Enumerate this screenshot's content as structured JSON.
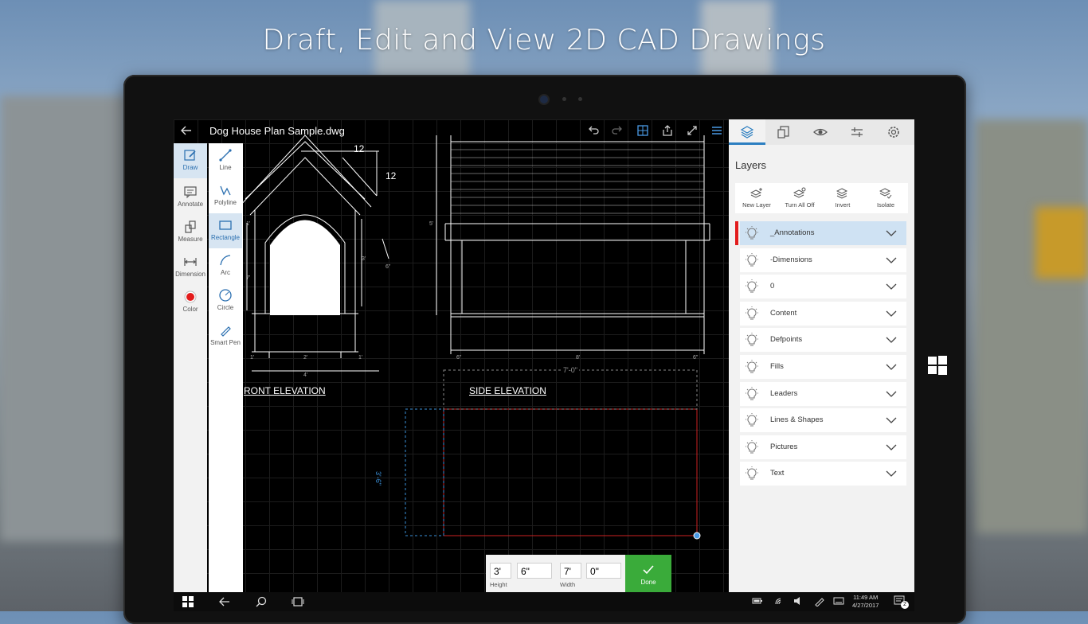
{
  "headline": "Draft, Edit and View 2D CAD Drawings",
  "document": {
    "title": "Dog House Plan Sample.dwg"
  },
  "toolbar_icons": [
    "undo-icon",
    "redo-icon",
    "grid-icon",
    "share-icon",
    "fullscreen-icon",
    "menu-icon"
  ],
  "tools": {
    "col1": [
      {
        "label": "Draw",
        "icon": "draw-icon",
        "active": true
      },
      {
        "label": "Annotate",
        "icon": "annotate-icon",
        "active": false
      },
      {
        "label": "Measure",
        "icon": "measure-icon",
        "active": false
      },
      {
        "label": "Dimension",
        "icon": "dimension-icon",
        "active": false
      },
      {
        "label": "Color",
        "icon": "color-dot-icon",
        "active": false
      }
    ],
    "col2": [
      {
        "label": "Line",
        "icon": "line-icon",
        "active": false
      },
      {
        "label": "Polyline",
        "icon": "polyline-icon",
        "active": false
      },
      {
        "label": "Rectangle",
        "icon": "rectangle-icon",
        "active": true
      },
      {
        "label": "Arc",
        "icon": "arc-icon",
        "active": false
      },
      {
        "label": "Circle",
        "icon": "circle-icon",
        "active": false
      },
      {
        "label": "Smart Pen",
        "icon": "smart-pen-icon",
        "active": false
      }
    ]
  },
  "drawing": {
    "front_label": "RONT ELEVATION",
    "side_label": "SIDE ELEVATION",
    "slope_a": "12",
    "slope_b": "12",
    "front_dims": [
      "1'",
      "2'",
      "1'",
      "4'"
    ],
    "front_small_dims": [
      "3'",
      "6\"",
      "7'",
      "1'"
    ],
    "side_dims": [
      "6\"",
      "8'",
      "6\""
    ],
    "side_small_dim": "5'",
    "top_dim": "7'-0\"",
    "side_dim_vertical": "3'-6\""
  },
  "panel": {
    "tabs": [
      "layers-icon",
      "blocks-icon",
      "view-icon",
      "properties-icon",
      "settings-icon"
    ],
    "title": "Layers",
    "actions": [
      {
        "label": "New Layer",
        "icon": "new-layer-icon"
      },
      {
        "label": "Turn All Off",
        "icon": "turn-all-off-icon"
      },
      {
        "label": "Invert",
        "icon": "invert-icon"
      },
      {
        "label": "Isolate",
        "icon": "isolate-icon"
      }
    ],
    "layers": [
      {
        "name": "_Annotations",
        "selected": true
      },
      {
        "name": "-Dimensions",
        "selected": false
      },
      {
        "name": "0",
        "selected": false
      },
      {
        "name": "Content",
        "selected": false
      },
      {
        "name": "Defpoints",
        "selected": false
      },
      {
        "name": "Fills",
        "selected": false
      },
      {
        "name": "Leaders",
        "selected": false
      },
      {
        "name": "Lines & Shapes",
        "selected": false
      },
      {
        "name": "Pictures",
        "selected": false
      },
      {
        "name": "Text",
        "selected": false
      }
    ]
  },
  "dim_input": {
    "height_ft": "3'",
    "height_in": "6\"",
    "height_label": "Height",
    "width_ft": "7'",
    "width_in": "0\"",
    "width_label": "Width",
    "done_label": "Done"
  },
  "taskbar": {
    "time": "11:49 AM",
    "date": "4/27/2017",
    "notification_count": "2"
  },
  "colors": {
    "accent": "#2d7fc1",
    "done_green": "#3aab3a",
    "selection_red": "#e31c1c",
    "rect_red": "#cc2222",
    "dim_blue": "#3a8fd8"
  }
}
